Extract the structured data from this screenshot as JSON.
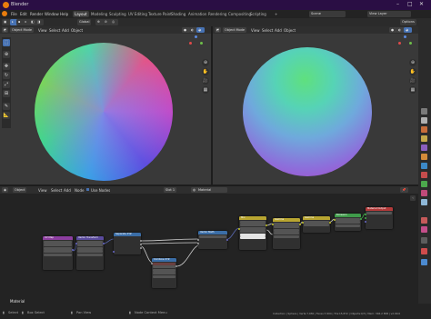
{
  "window": {
    "title": "Blender"
  },
  "menu": {
    "items": [
      "File",
      "Edit",
      "Render",
      "Window",
      "Help"
    ]
  },
  "workspaces": [
    "Layout",
    "Modeling",
    "Sculpting",
    "UV Editing",
    "Texture Paint",
    "Shading",
    "Animation",
    "Rendering",
    "Compositing",
    "Scripting"
  ],
  "active_workspace": "Layout",
  "topright": {
    "scene": "Scene",
    "view_layer": "View Layer"
  },
  "toolbar": {
    "global": "Global",
    "options": "Options"
  },
  "viewport_left": {
    "mode": "Object Mode",
    "view": "View",
    "select": "Select",
    "add": "Add",
    "object": "Object"
  },
  "viewport_right": {
    "mode": "Object Mode",
    "view": "View",
    "select": "Select",
    "add": "Add",
    "object": "Object"
  },
  "node_editor": {
    "type": "Object",
    "view": "View",
    "select": "Select",
    "add": "Add",
    "node": "Node",
    "use_nodes": "Use Nodes",
    "slot": "Slot 1",
    "material": "Material",
    "label": "Material"
  },
  "nodes": [
    {
      "title": "UV Map",
      "color": "#8d3ea0"
    },
    {
      "title": "Vector Transform",
      "color": "#5b4b9e"
    },
    {
      "title": "Separate XYZ",
      "color": "#3b6ea7"
    },
    {
      "title": "Combine XYZ",
      "color": "#3b6ea7"
    },
    {
      "title": "Vector Math",
      "color": "#3b6ea7"
    },
    {
      "title": "Mix",
      "color": "#b8a531"
    },
    {
      "title": "Gamma",
      "color": "#b8a531"
    },
    {
      "title": "Gamma",
      "color": "#b8a531"
    },
    {
      "title": "Emission",
      "color": "#3f9a4a"
    },
    {
      "title": "Material Output",
      "color": "#b33a3a"
    }
  ],
  "status": {
    "select": "Select",
    "box_select": "Box Select",
    "pan_view": "Pan View",
    "context_menu": "Node Context Menu",
    "stats": "Collection | Sphere | Verts:7,936 | Faces:7,904 | Tris:15,872 | Objects:0/3 | Mem: 346.2 MiB | v2.90.0"
  }
}
